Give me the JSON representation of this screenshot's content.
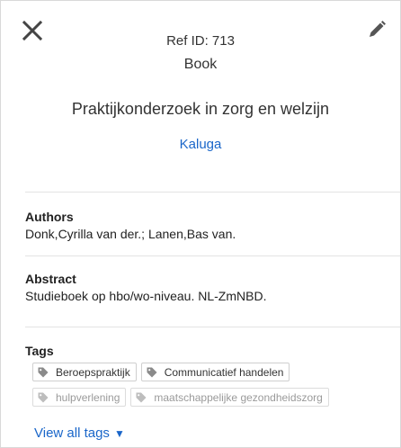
{
  "header": {
    "ref_id": "Ref ID: 713",
    "ref_type": "Book",
    "close_icon": "close-icon",
    "edit_icon": "pencil-icon"
  },
  "reference": {
    "title": "Praktijkonderzoek in zorg en welzijn",
    "location": "Kaluga"
  },
  "authors": {
    "label": "Authors",
    "value": "Donk,Cyrilla van der.; Lanen,Bas van."
  },
  "abstract": {
    "label": "Abstract",
    "value": "Studieboek op hbo/wo-niveau. NL-ZmNBD."
  },
  "tags": {
    "label": "Tags",
    "items": [
      {
        "label": "Beroepspraktijk",
        "muted": false
      },
      {
        "label": "Communicatief handelen",
        "muted": false
      },
      {
        "label": "hulpverlening",
        "muted": true
      },
      {
        "label": "maatschappelijke gezondheidszorg",
        "muted": true
      }
    ],
    "tag_icon": "tag-icon",
    "view_all_label": "View all tags",
    "view_all_caret": "▼"
  },
  "colors": {
    "link": "#1a66c9",
    "muted_tag_text": "#9a9a9a"
  }
}
